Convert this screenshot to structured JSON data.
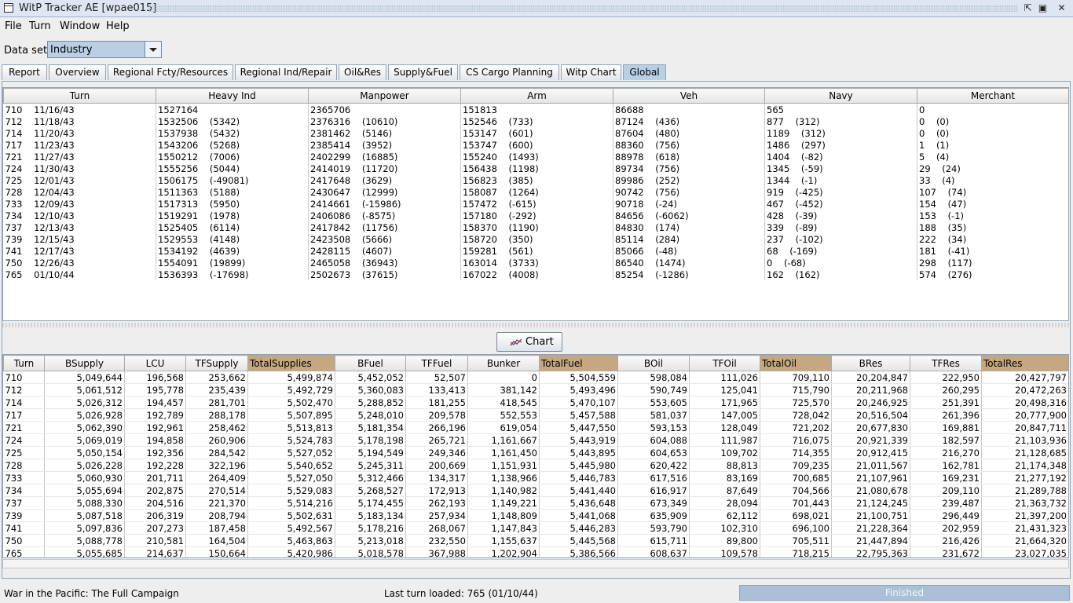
{
  "window": {
    "title": "WitP Tracker AE [wpae015]"
  },
  "menu": [
    "File",
    "Turn",
    "Window",
    "Help"
  ],
  "dataset": {
    "label": "Data set:",
    "value": "Industry"
  },
  "tabs": [
    "Report",
    "Overview",
    "Regional Fcty/Resources",
    "Regional Ind/Repair",
    "Oil&Res",
    "Supply&Fuel",
    "CS Cargo Planning",
    "Witp Chart",
    "Global"
  ],
  "active_tab": "Global",
  "top_table": {
    "columns": [
      "Turn",
      "Heavy Ind",
      "Manpower",
      "Arm",
      "Veh",
      "Navy",
      "Merchant"
    ],
    "rows": [
      [
        "710    11/16/43",
        "1527164",
        "2365706",
        "151813",
        "86688",
        "565",
        "0"
      ],
      [
        "712    11/18/43",
        "1532506    (5342)",
        "2376316    (10610)",
        "152546    (733)",
        "87124    (436)",
        "877    (312)",
        "0    (0)"
      ],
      [
        "714    11/20/43",
        "1537938    (5432)",
        "2381462    (5146)",
        "153147    (601)",
        "87604    (480)",
        "1189    (312)",
        "0    (0)"
      ],
      [
        "717    11/23/43",
        "1543206    (5268)",
        "2385414    (3952)",
        "153747    (600)",
        "88360    (756)",
        "1486    (297)",
        "1    (1)"
      ],
      [
        "721    11/27/43",
        "1550212    (7006)",
        "2402299    (16885)",
        "155240    (1493)",
        "88978    (618)",
        "1404    (-82)",
        "5    (4)"
      ],
      [
        "724    11/30/43",
        "1555256    (5044)",
        "2414019    (11720)",
        "156438    (1198)",
        "89734    (756)",
        "1345    (-59)",
        "29    (24)"
      ],
      [
        "725    12/01/43",
        "1506175    (-49081)",
        "2417648    (3629)",
        "156823    (385)",
        "89986    (252)",
        "1344    (-1)",
        "33    (4)"
      ],
      [
        "728    12/04/43",
        "1511363    (5188)",
        "2430647    (12999)",
        "158087    (1264)",
        "90742    (756)",
        "919    (-425)",
        "107    (74)"
      ],
      [
        "733    12/09/43",
        "1517313    (5950)",
        "2414661    (-15986)",
        "157472    (-615)",
        "90718    (-24)",
        "467    (-452)",
        "154    (47)"
      ],
      [
        "734    12/10/43",
        "1519291    (1978)",
        "2406086    (-8575)",
        "157180    (-292)",
        "84656    (-6062)",
        "428    (-39)",
        "153    (-1)"
      ],
      [
        "737    12/13/43",
        "1525405    (6114)",
        "2417842    (11756)",
        "158370    (1190)",
        "84830    (174)",
        "339    (-89)",
        "188    (35)"
      ],
      [
        "739    12/15/43",
        "1529553    (4148)",
        "2423508    (5666)",
        "158720    (350)",
        "85114    (284)",
        "237    (-102)",
        "222    (34)"
      ],
      [
        "741    12/17/43",
        "1534192    (4639)",
        "2428115    (4607)",
        "159281    (561)",
        "85066    (-48)",
        "68    (-169)",
        "181    (-41)"
      ],
      [
        "750    12/26/43",
        "1554091    (19899)",
        "2465058    (36943)",
        "163014    (3733)",
        "86540    (1474)",
        "0    (-68)",
        "298    (117)"
      ],
      [
        "765    01/10/44",
        "1536393    (-17698)",
        "2502673    (37615)",
        "167022    (4008)",
        "85254    (-1286)",
        "162    (162)",
        "574    (276)"
      ]
    ]
  },
  "chart_button": {
    "label": "Chart"
  },
  "bottom_table": {
    "columns": [
      "Turn",
      "BSupply",
      "LCU",
      "TFSupply",
      "TotalSupplies",
      "BFuel",
      "TFFuel",
      "Bunker",
      "TotalFuel",
      "BOil",
      "TFOil",
      "TotalOil",
      "BRes",
      "TFRes",
      "TotalRes"
    ],
    "highlight_columns": [
      "TotalSupplies",
      "TotalFuel",
      "TotalOil",
      "TotalRes"
    ],
    "highlight_color": "#c5a882",
    "rows": [
      [
        "710",
        "5,049,644",
        "196,568",
        "253,662",
        "5,499,874",
        "5,452,052",
        "52,507",
        "0",
        "5,504,559",
        "598,084",
        "111,026",
        "709,110",
        "20,204,847",
        "222,950",
        "20,427,797"
      ],
      [
        "712",
        "5,061,512",
        "195,778",
        "235,439",
        "5,492,729",
        "5,360,083",
        "133,413",
        "381,142",
        "5,493,496",
        "590,749",
        "125,041",
        "715,790",
        "20,211,968",
        "260,295",
        "20,472,263"
      ],
      [
        "714",
        "5,026,312",
        "194,457",
        "281,701",
        "5,502,470",
        "5,288,852",
        "181,255",
        "418,545",
        "5,470,107",
        "553,605",
        "171,965",
        "725,570",
        "20,246,925",
        "251,391",
        "20,498,316"
      ],
      [
        "717",
        "5,026,928",
        "192,789",
        "288,178",
        "5,507,895",
        "5,248,010",
        "209,578",
        "552,553",
        "5,457,588",
        "581,037",
        "147,005",
        "728,042",
        "20,516,504",
        "261,396",
        "20,777,900"
      ],
      [
        "721",
        "5,062,390",
        "192,961",
        "258,462",
        "5,513,813",
        "5,181,354",
        "266,196",
        "619,054",
        "5,447,550",
        "593,153",
        "128,049",
        "721,202",
        "20,677,830",
        "169,881",
        "20,847,711"
      ],
      [
        "724",
        "5,069,019",
        "194,858",
        "260,906",
        "5,524,783",
        "5,178,198",
        "265,721",
        "1,161,667",
        "5,443,919",
        "604,088",
        "111,987",
        "716,075",
        "20,921,339",
        "182,597",
        "21,103,936"
      ],
      [
        "725",
        "5,050,154",
        "192,356",
        "284,542",
        "5,527,052",
        "5,194,549",
        "249,346",
        "1,161,450",
        "5,443,895",
        "604,653",
        "109,702",
        "714,355",
        "20,912,415",
        "216,270",
        "21,128,685"
      ],
      [
        "728",
        "5,026,228",
        "192,228",
        "322,196",
        "5,540,652",
        "5,245,311",
        "200,669",
        "1,151,931",
        "5,445,980",
        "620,422",
        "88,813",
        "709,235",
        "21,011,567",
        "162,781",
        "21,174,348"
      ],
      [
        "733",
        "5,060,930",
        "201,711",
        "264,409",
        "5,527,050",
        "5,312,466",
        "134,317",
        "1,138,966",
        "5,446,783",
        "617,516",
        "83,169",
        "700,685",
        "21,107,961",
        "169,231",
        "21,277,192"
      ],
      [
        "734",
        "5,055,694",
        "202,875",
        "270,514",
        "5,529,083",
        "5,268,527",
        "172,913",
        "1,140,982",
        "5,441,440",
        "616,917",
        "87,649",
        "704,566",
        "21,080,678",
        "209,110",
        "21,289,788"
      ],
      [
        "737",
        "5,088,330",
        "204,516",
        "221,370",
        "5,514,216",
        "5,174,455",
        "262,193",
        "1,149,221",
        "5,436,648",
        "673,349",
        "28,094",
        "701,443",
        "21,124,245",
        "239,487",
        "21,363,732"
      ],
      [
        "739",
        "5,087,518",
        "206,319",
        "208,794",
        "5,502,631",
        "5,183,134",
        "257,934",
        "1,148,809",
        "5,441,068",
        "635,909",
        "62,112",
        "698,021",
        "21,100,751",
        "296,449",
        "21,397,200"
      ],
      [
        "741",
        "5,097,836",
        "207,273",
        "187,458",
        "5,492,567",
        "5,178,216",
        "268,067",
        "1,147,843",
        "5,446,283",
        "593,790",
        "102,310",
        "696,100",
        "21,228,364",
        "202,959",
        "21,431,323"
      ],
      [
        "750",
        "5,088,778",
        "210,581",
        "164,504",
        "5,463,863",
        "5,213,018",
        "232,550",
        "1,155,637",
        "5,445,568",
        "615,711",
        "89,800",
        "705,511",
        "21,447,894",
        "216,426",
        "21,664,320"
      ],
      [
        "765",
        "5,055,685",
        "214,637",
        "150,664",
        "5,420,986",
        "5,018,578",
        "367,988",
        "1,202,904",
        "5,386,566",
        "608,637",
        "109,578",
        "718,215",
        "22,795,363",
        "231,672",
        "23,027,035"
      ]
    ]
  },
  "status": {
    "left": "War in the Pacific: The Full Campaign",
    "middle": "Last turn loaded: 765 (01/10/44)",
    "progress_label": "Finished",
    "progress_fraction": 1.0
  }
}
